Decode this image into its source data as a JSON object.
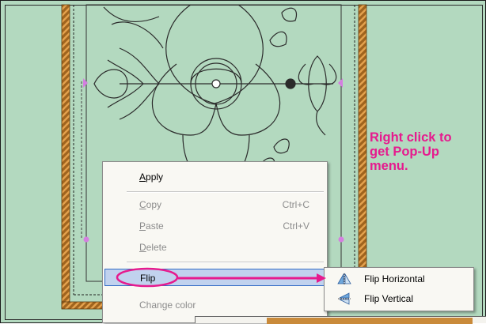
{
  "annotation": {
    "line1": "Right click to",
    "line2": "get Pop-Up",
    "line3": "menu."
  },
  "context_menu": {
    "items": [
      {
        "label": "Apply",
        "mnemonic": "A",
        "rest": "pply",
        "shortcut": "",
        "enabled": true
      },
      {
        "label": "Copy",
        "mnemonic": "C",
        "rest": "opy",
        "shortcut": "Ctrl+C",
        "enabled": false
      },
      {
        "label": "Paste",
        "mnemonic": "P",
        "rest": "aste",
        "shortcut": "Ctrl+V",
        "enabled": false
      },
      {
        "label": "Delete",
        "mnemonic": "D",
        "rest": "elete",
        "shortcut": "",
        "enabled": false
      },
      {
        "label": "Flip",
        "shortcut": "",
        "enabled": true,
        "highlighted": true,
        "has_submenu": true
      },
      {
        "label": "Change color",
        "shortcut": "",
        "enabled": false
      }
    ]
  },
  "submenu": {
    "items": [
      {
        "label": "Flip Horizontal",
        "icon": "flip-horizontal-icon"
      },
      {
        "label": "Flip Vertical",
        "icon": "flip-vertical-icon"
      }
    ]
  },
  "colors": {
    "canvas_bg": "#b3d9bf",
    "annotation": "#e61a8e",
    "highlight": "#c1d2ee",
    "border_brown": "#a0641e",
    "handle": "#d47fe0"
  }
}
